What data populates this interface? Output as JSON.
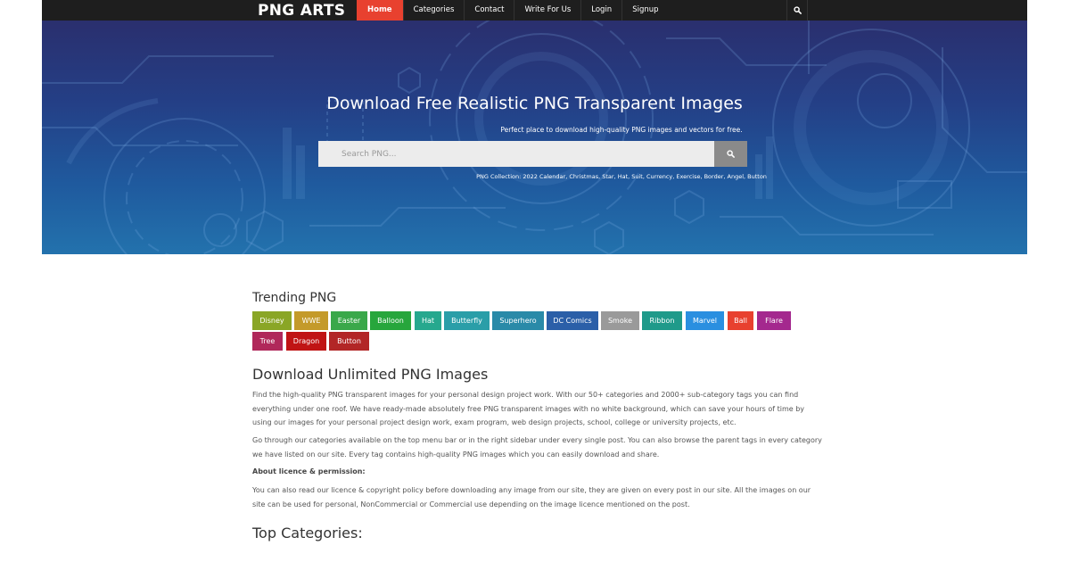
{
  "header": {
    "logo": "PNG ARTS",
    "nav": [
      {
        "label": "Home",
        "active": true
      },
      {
        "label": "Categories",
        "active": false
      },
      {
        "label": "Contact",
        "active": false
      },
      {
        "label": "Write For Us",
        "active": false
      },
      {
        "label": "Login",
        "active": false
      },
      {
        "label": "Signup",
        "active": false
      }
    ],
    "search_icon": "search-icon"
  },
  "hero": {
    "title": "Download Free Realistic PNG Transparent Images",
    "subtitle": "Perfect place to download high-quality PNG images and vectors for free.",
    "search_placeholder": "Search PNG...",
    "search_icon": "search-icon",
    "collection": "PNG Collection: 2022 Calendar, Christmas, Star, Hat, Suit, Currency, Exercise, Border, Angel, Button"
  },
  "trending": {
    "heading": "Trending PNG",
    "tags": [
      {
        "label": "Disney",
        "color": "#8aa626"
      },
      {
        "label": "WWE",
        "color": "#c49a2a"
      },
      {
        "label": "Easter",
        "color": "#3aa84a"
      },
      {
        "label": "Balloon",
        "color": "#27a63c"
      },
      {
        "label": "Hat",
        "color": "#26a88e"
      },
      {
        "label": "Butterfly",
        "color": "#2a9ea8"
      },
      {
        "label": "Superhero",
        "color": "#2a8aa8"
      },
      {
        "label": "DC Comics",
        "color": "#2b5fa8"
      },
      {
        "label": "Smoke",
        "color": "#9a9a9a"
      },
      {
        "label": "Ribbon",
        "color": "#1f9a8a"
      },
      {
        "label": "Marvel",
        "color": "#2a8fe0"
      },
      {
        "label": "Ball",
        "color": "#e8412f"
      },
      {
        "label": "Flare",
        "color": "#a4288e"
      },
      {
        "label": "Tree",
        "color": "#b0285a"
      },
      {
        "label": "Dragon",
        "color": "#c01414"
      },
      {
        "label": "Button",
        "color": "#b22626"
      }
    ]
  },
  "main": {
    "heading": "Download Unlimited PNG Images",
    "paragraph1": "Find the high-quality PNG transparent images for your personal design project work. With our 50+ categories and 2000+ sub-category tags you can find everything under one roof. We have ready-made absolutely free PNG transparent images with no white background, which can save your hours of time by using our images for your personal project design work, exam program, web design projects, school, college or university projects, etc.",
    "paragraph2": "Go through our categories available on the top menu bar or in the right sidebar under every single post. You can also browse the parent tags in every category we have listed on our site. Every tag contains high-quality PNG images which you can easily download and share.",
    "licence_heading": "About licence & permission:",
    "paragraph3": "You can also read our licence & copyright policy before downloading any image from our site, they are given on every post in our site. All the images on our site can be used for personal, NonCommercial or Commercial use depending on the image licence mentioned on the post.",
    "top_categories": "Top Categories:"
  }
}
